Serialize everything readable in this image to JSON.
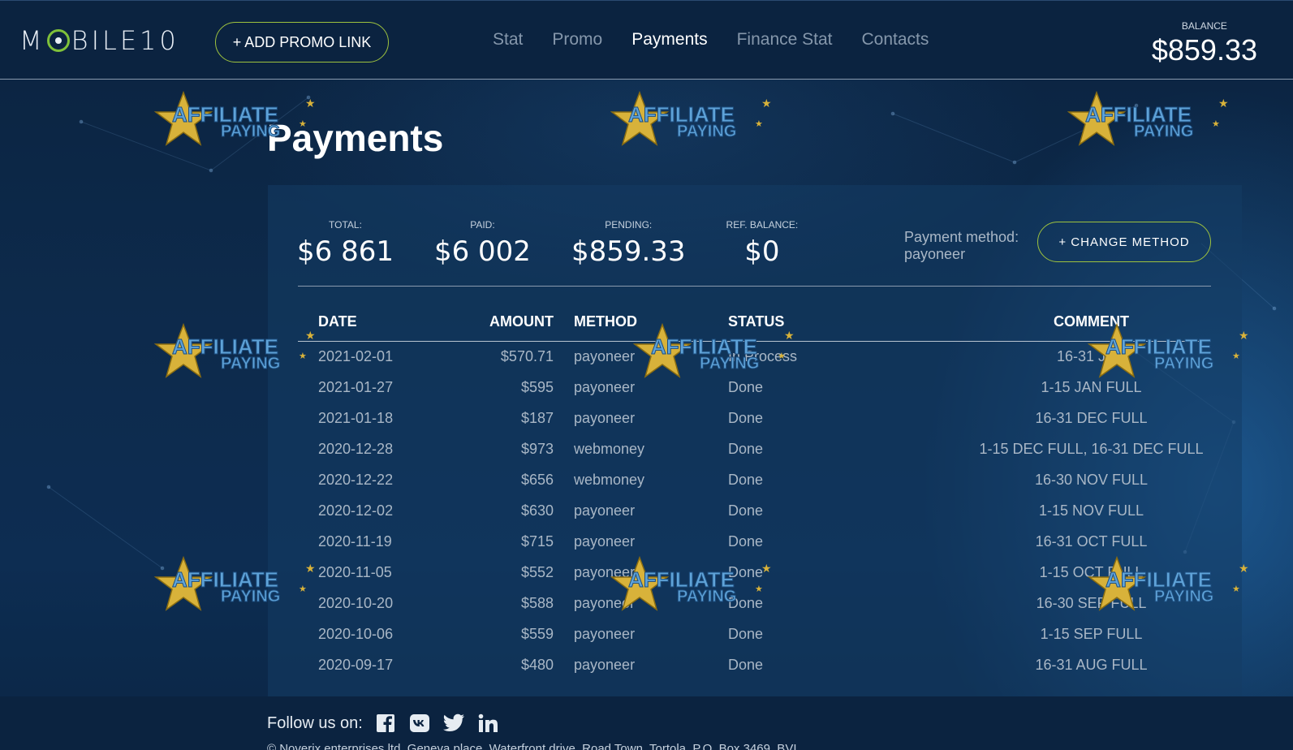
{
  "header": {
    "logo_text": "MOBILE10",
    "add_promo_label": "+ ADD PROMO LINK",
    "nav": [
      {
        "label": "Stat"
      },
      {
        "label": "Promo"
      },
      {
        "label": "Payments",
        "active": true
      },
      {
        "label": "Finance Stat"
      },
      {
        "label": "Contacts"
      }
    ],
    "balance_label": "BALANCE",
    "balance_value": "$859.33"
  },
  "page": {
    "title": "Payments"
  },
  "summary": {
    "total_label": "TOTAL:",
    "total_value": "$6 861",
    "paid_label": "PAID:",
    "paid_value": "$6 002",
    "pending_label": "PENDING:",
    "pending_value": "$859.33",
    "ref_label": "REF. BALANCE:",
    "ref_value": "$0",
    "method_label": "Payment method:",
    "method_value": "payoneer",
    "change_method_label": "+ CHANGE METHOD"
  },
  "table": {
    "headers": {
      "date": "DATE",
      "amount": "AMOUNT",
      "method": "METHOD",
      "status": "STATUS",
      "comment": "COMMENT"
    },
    "rows": [
      {
        "date": "2021-02-01",
        "amount": "$570.71",
        "method": "payoneer",
        "status": "In Process",
        "comment": "16-31 JAN"
      },
      {
        "date": "2021-01-27",
        "amount": "$595",
        "method": "payoneer",
        "status": "Done",
        "comment": "1-15 JAN FULL"
      },
      {
        "date": "2021-01-18",
        "amount": "$187",
        "method": "payoneer",
        "status": "Done",
        "comment": "16-31 DEC FULL"
      },
      {
        "date": "2020-12-28",
        "amount": "$973",
        "method": "webmoney",
        "status": "Done",
        "comment": "1-15 DEC FULL, 16-31 DEC FULL"
      },
      {
        "date": "2020-12-22",
        "amount": "$656",
        "method": "webmoney",
        "status": "Done",
        "comment": "16-30 NOV FULL"
      },
      {
        "date": "2020-12-02",
        "amount": "$630",
        "method": "payoneer",
        "status": "Done",
        "comment": "1-15 NOV FULL"
      },
      {
        "date": "2020-11-19",
        "amount": "$715",
        "method": "payoneer",
        "status": "Done",
        "comment": "16-31 OCT FULL"
      },
      {
        "date": "2020-11-05",
        "amount": "$552",
        "method": "payoneer",
        "status": "Done",
        "comment": "1-15 OCT FULL"
      },
      {
        "date": "2020-10-20",
        "amount": "$588",
        "method": "payoneer",
        "status": "Done",
        "comment": "16-30 SEP FULL"
      },
      {
        "date": "2020-10-06",
        "amount": "$559",
        "method": "payoneer",
        "status": "Done",
        "comment": "1-15 SEP FULL"
      },
      {
        "date": "2020-09-17",
        "amount": "$480",
        "method": "payoneer",
        "status": "Done",
        "comment": "16-31 AUG FULL"
      }
    ]
  },
  "watermark": {
    "line1": "AFFILIATE",
    "line2": "PAYING"
  },
  "footer": {
    "follow_label": "Follow us on:",
    "socials": [
      {
        "icon": "facebook-icon",
        "glyph": "f"
      },
      {
        "icon": "vk-icon",
        "glyph": "vk"
      },
      {
        "icon": "twitter-icon",
        "glyph": "🐦"
      },
      {
        "icon": "linkedin-icon",
        "glyph": "in"
      }
    ],
    "copyright": "© Noverix enterprises ltd. Geneva place, Waterfront drive, Road Town, Tortola, P.O. Box 3469, BVI"
  },
  "colors": {
    "accent": "#9ec23e",
    "background": "#0b2340",
    "muted_text": "#a9b7c6"
  }
}
